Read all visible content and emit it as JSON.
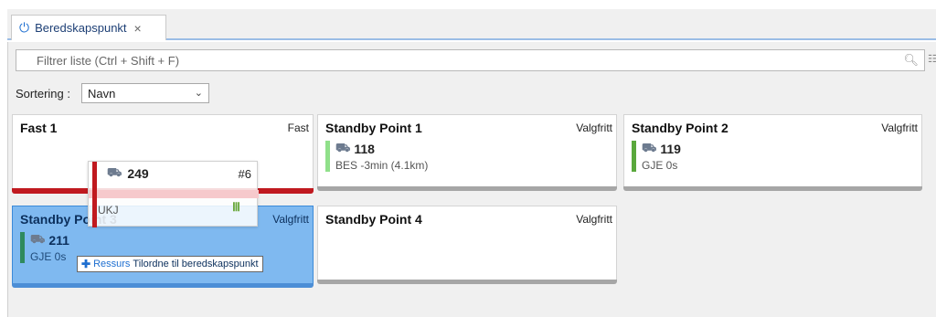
{
  "tab": {
    "label": "Beredskapspunkt",
    "power_icon": "power-icon",
    "close_glyph": "×"
  },
  "filter": {
    "placeholder": "Filtrer liste (Ctrl + Shift + F)"
  },
  "sort": {
    "label": "Sortering :",
    "value": "Navn"
  },
  "cards": {
    "fast1": {
      "title": "Fast 1",
      "kind": "Fast"
    },
    "sp1": {
      "title": "Standby Point 1",
      "kind": "Valgfritt",
      "vehicle": "118",
      "status": "BES -3min  (4.1km)",
      "bar_color": "#90e08a"
    },
    "sp2": {
      "title": "Standby Point 2",
      "kind": "Valgfritt",
      "vehicle": "119",
      "status": "GJE 0s",
      "bar_color": "#5aa83c"
    },
    "sp3": {
      "title": "Standby Point 3",
      "kind": "Valgfritt",
      "vehicle": "211",
      "status": "GJE 0s",
      "bar_color": "#2f8a5e"
    },
    "sp4": {
      "title": "Standby Point 4",
      "kind": "Valgfritt"
    }
  },
  "drag": {
    "vehicle": "249",
    "hash": "#6",
    "status": "UKJ",
    "bar_color": "#c0191f"
  },
  "tooltip": {
    "resource": "Ressurs",
    "text": "Tilordne til beredskapspunkt"
  }
}
